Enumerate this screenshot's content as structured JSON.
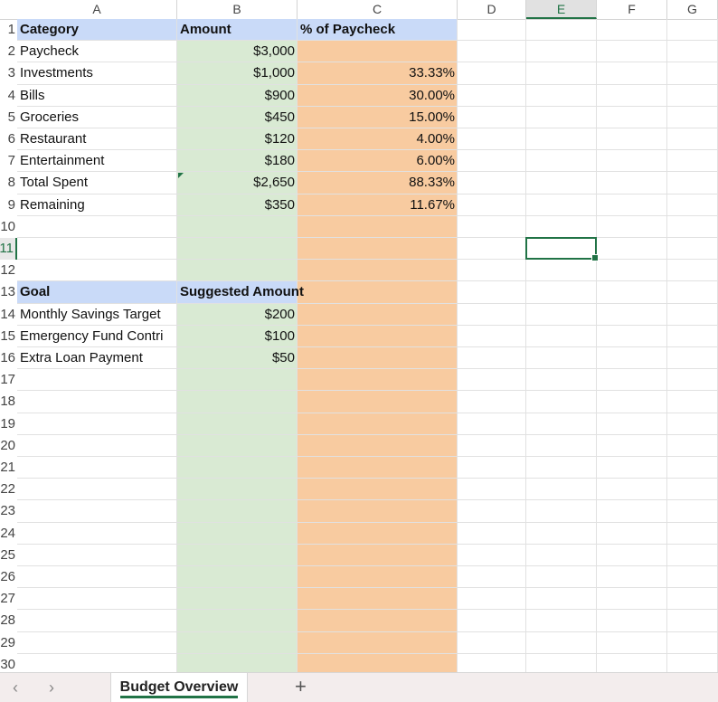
{
  "columns": [
    "A",
    "B",
    "C",
    "D",
    "E",
    "F",
    "G"
  ],
  "rows": [
    "1",
    "2",
    "3",
    "4",
    "5",
    "6",
    "7",
    "8",
    "9",
    "10",
    "11",
    "12",
    "13",
    "14",
    "15",
    "16",
    "17",
    "18",
    "19",
    "20",
    "21",
    "22",
    "23",
    "24",
    "25",
    "26",
    "27",
    "28",
    "29",
    "30"
  ],
  "table1": {
    "headers": [
      "Category",
      "Amount",
      "% of Paycheck"
    ],
    "rows": [
      [
        "Paycheck",
        "$3,000",
        ""
      ],
      [
        "Investments",
        "$1,000",
        "33.33%"
      ],
      [
        "Bills",
        "$900",
        "30.00%"
      ],
      [
        "Groceries",
        "$450",
        "15.00%"
      ],
      [
        "Restaurant",
        "$120",
        "4.00%"
      ],
      [
        "Entertainment",
        "$180",
        "6.00%"
      ],
      [
        "Total Spent",
        "$2,650",
        "88.33%"
      ],
      [
        "Remaining",
        "$350",
        "11.67%"
      ]
    ]
  },
  "table2": {
    "headers": [
      "Goal",
      "Suggested Amount"
    ],
    "rows": [
      [
        "Monthly Savings Target",
        "$200"
      ],
      [
        "Emergency Fund Contri",
        "$100"
      ],
      [
        "Extra Loan Payment",
        "$50"
      ]
    ]
  },
  "selected_cell": "E11",
  "sheet_tab": "Budget Overview",
  "nav": {
    "prev": "‹",
    "next": "›",
    "add": "+"
  },
  "colors": {
    "header_fill": "#c9daf8",
    "amount_fill": "#d9ead3",
    "percent_fill": "#f8cba0",
    "accent": "#217346"
  }
}
